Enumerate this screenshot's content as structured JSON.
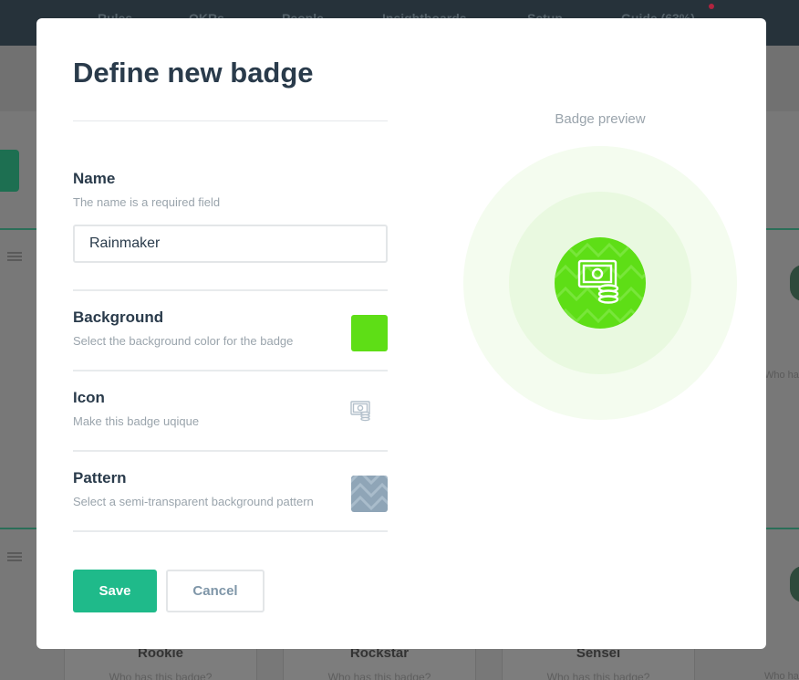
{
  "background_app": {
    "nav": [
      "Rules",
      "OKRs",
      "People",
      "Insightboards",
      "Setup",
      "Guide (63%)"
    ],
    "cards": [
      {
        "name": "Rookie",
        "question": "Who has this badge?"
      },
      {
        "name": "Rockstar",
        "question": "Who has this badge?"
      },
      {
        "name": "Sensei",
        "question": "Who has this badge?"
      }
    ],
    "right_card_question": "Who has",
    "right_card_question_2": "Who has"
  },
  "modal": {
    "title": "Define new badge",
    "name_field": {
      "label": "Name",
      "help": "The name is a required field",
      "value": "Rainmaker"
    },
    "background_field": {
      "label": "Background",
      "help": "Select the background color for the badge",
      "color": "#5ede16"
    },
    "icon_field": {
      "label": "Icon",
      "help": "Make this badge uqique",
      "icon": "money-cash-icon"
    },
    "pattern_field": {
      "label": "Pattern",
      "help": "Select a semi-transparent background pattern",
      "pattern": "chevron-pattern"
    },
    "save_label": "Save",
    "cancel_label": "Cancel",
    "preview": {
      "label": "Badge preview",
      "badge_color": "#5ede16",
      "icon": "money-cash-icon",
      "pattern": "chevron-pattern"
    }
  }
}
